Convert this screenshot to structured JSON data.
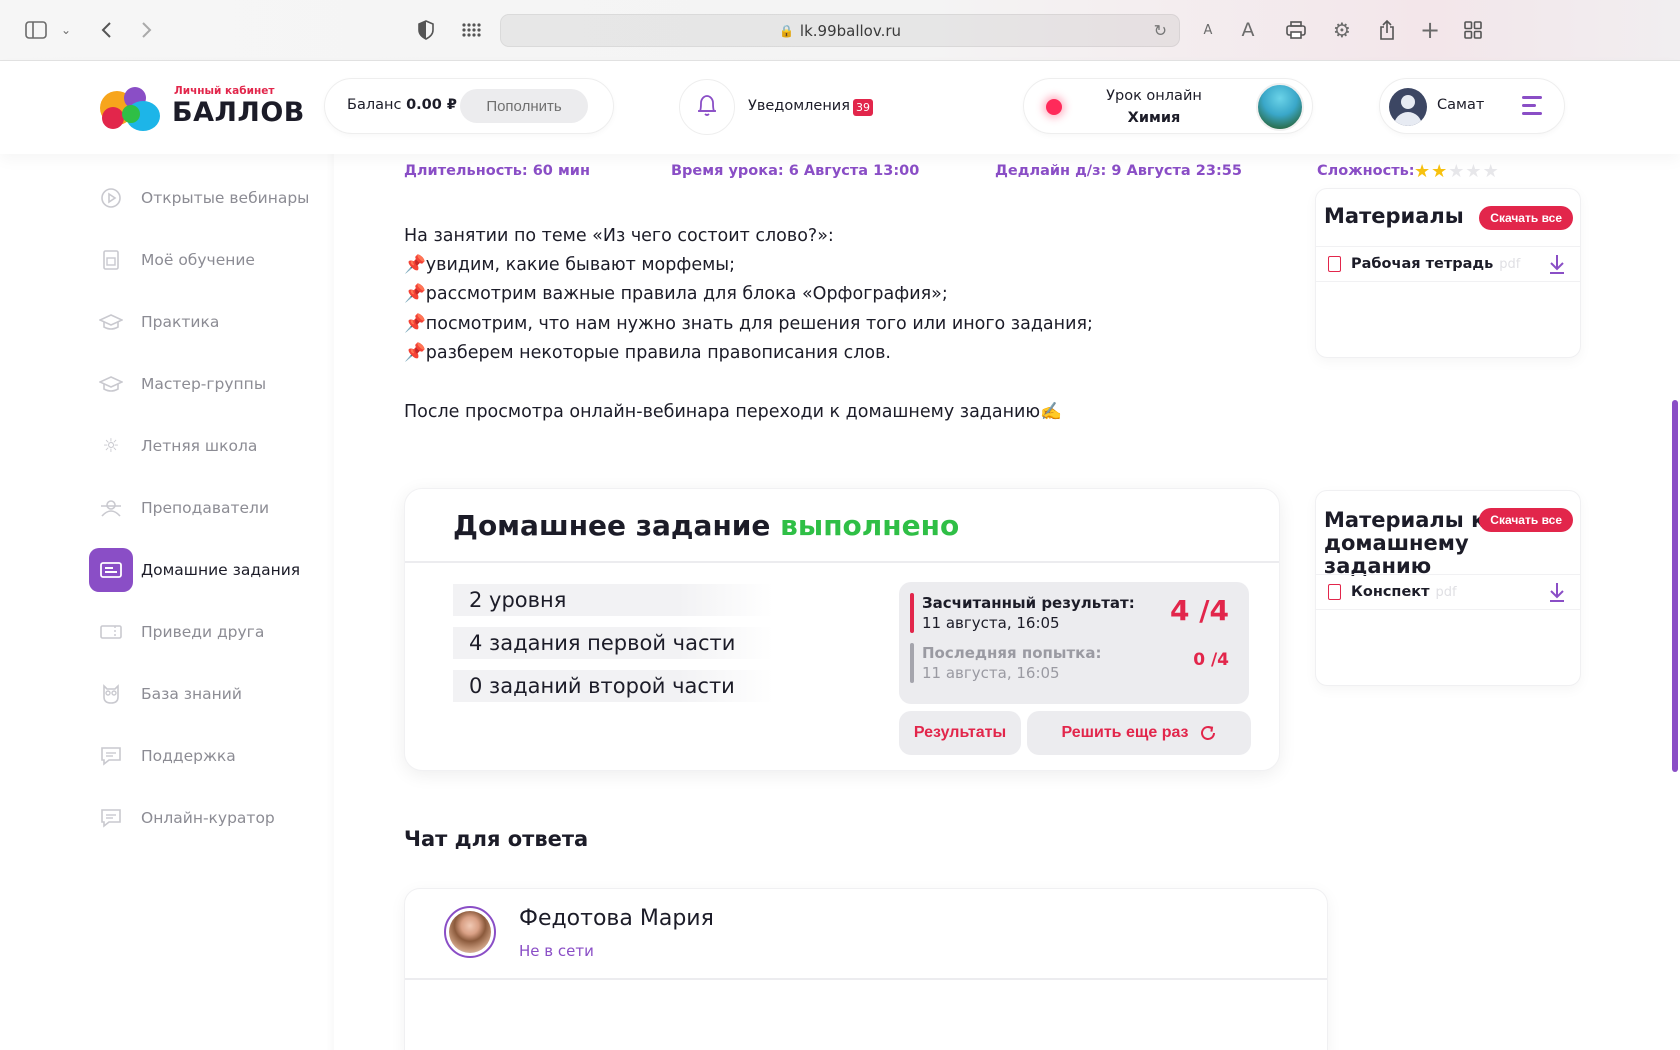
{
  "browser": {
    "url": "lk.99ballov.ru",
    "font_small": "A",
    "font_large": "A"
  },
  "header": {
    "logo_sub": "Личный кабинет",
    "logo_title": "БАЛЛОВ",
    "balance_label": "Баланс",
    "balance_value": "0.00 ₽",
    "topup_label": "Пополнить",
    "notifications_label": "Уведомления",
    "notifications_count": "39",
    "lesson_online_label": "Урок онлайн",
    "lesson_subject": "Химия",
    "user_name": "Самат"
  },
  "sidebar": {
    "items": [
      {
        "label": "Открытые вебинары",
        "icon": "play-circle-icon",
        "active": false
      },
      {
        "label": "Моё обучение",
        "icon": "book-icon",
        "active": false
      },
      {
        "label": "Практика",
        "icon": "graduation-cap-icon",
        "active": false
      },
      {
        "label": "Мастер-группы",
        "icon": "graduation-cap-icon",
        "active": false
      },
      {
        "label": "Летняя школа",
        "icon": "sun-icon",
        "active": false
      },
      {
        "label": "Преподаватели",
        "icon": "teacher-icon",
        "active": false
      },
      {
        "label": "Домашние задания",
        "icon": "homework-icon",
        "active": true
      },
      {
        "label": "Приведи друга",
        "icon": "ticket-icon",
        "active": false
      },
      {
        "label": "База знаний",
        "icon": "owl-icon",
        "active": false
      },
      {
        "label": "Поддержка",
        "icon": "chat-icon",
        "active": false
      },
      {
        "label": "Онлайн-куратор",
        "icon": "chat-icon",
        "active": false
      }
    ]
  },
  "lesson": {
    "duration": "Длительность: 60 мин",
    "time": "Время урока: 6 Августа 13:00",
    "deadline": "Дедлайн д/з: 9 Августа 23:55",
    "difficulty_label": "Сложность:",
    "difficulty_stars": 2,
    "difficulty_max": 5,
    "description_intro": "На занятии по теме «Из чего состоит слово?»:",
    "description_points": [
      "увидим, какие бывают морфемы;",
      "рассмотрим важные правила для блока «Орфография»;",
      "посмотрим, что нам нужно знать для решения того или иного задания;",
      "разберем некоторые правила правописания слов."
    ],
    "description_after": "После просмотра онлайн-вебинара переходи к домашнему заданию✍️"
  },
  "materials": {
    "title": "Материалы",
    "download_all": "Скачать все",
    "files": [
      {
        "name": "Рабочая тетрадь",
        "ext": "pdf"
      }
    ]
  },
  "hw_materials": {
    "title_line1": "Материалы к",
    "title_line2": "домашнему заданию",
    "download_all": "Скачать все",
    "files": [
      {
        "name": "Конспект",
        "ext": "pdf"
      }
    ]
  },
  "homework": {
    "title": "Домашнее задание",
    "status": "выполнено",
    "stats": [
      "2 уровня",
      "4 задания первой части",
      "0 заданий второй части"
    ],
    "counted_label": "Засчитанный результат:",
    "counted_date": "11 августа, 16:05",
    "counted_score": "4 /4",
    "last_label": "Последняя попытка:",
    "last_date": "11 августа, 16:05",
    "last_score": "0 /4",
    "results_button": "Результаты",
    "retry_button": "Решить еще раз"
  },
  "chat": {
    "title": "Чат для ответа",
    "tutor_name": "Федотова Мария",
    "tutor_status": "Не в сети"
  },
  "colors": {
    "accent_purple": "#8a4ec6",
    "accent_red": "#e2264b",
    "success_green": "#2fbf46"
  }
}
